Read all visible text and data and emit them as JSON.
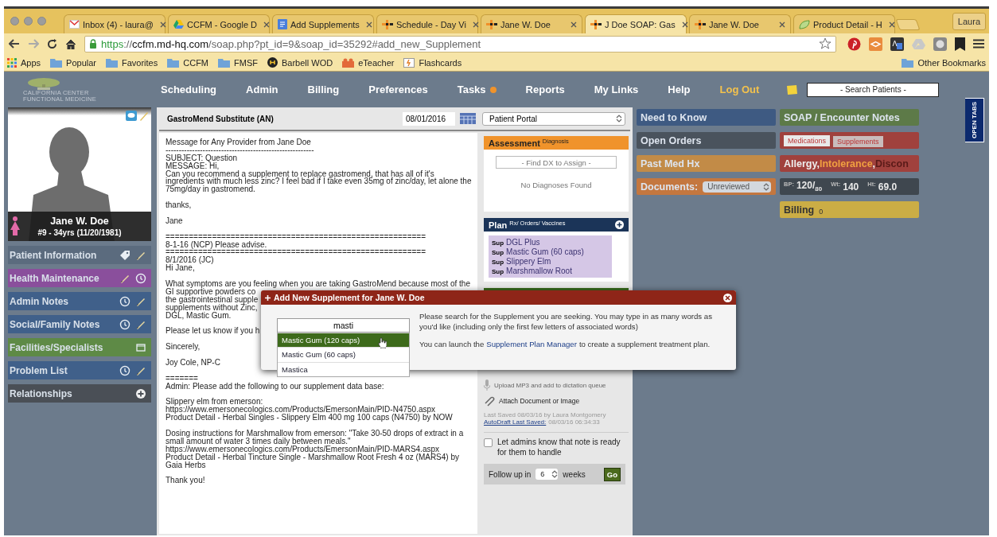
{
  "browser": {
    "tabs": [
      {
        "title": "Inbox (4) - laura@",
        "kind": "mail",
        "selected": false
      },
      {
        "title": "CCFM - Google D",
        "kind": "drive",
        "selected": false
      },
      {
        "title": "Add Supplements",
        "kind": "doc",
        "selected": false
      },
      {
        "title": "Schedule - Day Vi",
        "kind": "app",
        "selected": false
      },
      {
        "title": "Jane W. Doe",
        "kind": "app",
        "selected": false
      },
      {
        "title": "J Doe SOAP: Gas",
        "kind": "app",
        "selected": true
      },
      {
        "title": "Jane W. Doe",
        "kind": "app",
        "selected": false
      },
      {
        "title": "Product Detail - H",
        "kind": "leaf",
        "selected": false
      }
    ],
    "profile": "Laura",
    "url": [
      {
        "text": "https",
        "kind": "scheme"
      },
      {
        "text": "://",
        "kind": "sep"
      },
      {
        "text": "ccfm.md-hq.com",
        "kind": "host"
      },
      {
        "text": "/soap.php?pt_id=9&soap_id=35292#add_new_Supplement",
        "kind": "path"
      }
    ],
    "bookmarks": [
      {
        "label": "Apps",
        "kind": "apps"
      },
      {
        "label": "Popular",
        "kind": "folder"
      },
      {
        "label": "Favorites",
        "kind": "folder"
      },
      {
        "label": "CCFM",
        "kind": "folder"
      },
      {
        "label": "FMSF",
        "kind": "folder"
      },
      {
        "label": "Barbell WOD",
        "kind": "barbell"
      },
      {
        "label": "eTeacher",
        "kind": "teacher"
      },
      {
        "label": "Flashcards",
        "kind": "cards"
      }
    ],
    "other_bookmarks": "Other Bookmarks"
  },
  "header": {
    "logo": [
      "CALIFORNIA CENTER",
      "FUNCTIONAL MEDICINE"
    ],
    "nav": [
      {
        "label": "Scheduling",
        "kind": "link"
      },
      {
        "label": "Admin",
        "kind": "link"
      },
      {
        "label": "Billing",
        "kind": "link"
      },
      {
        "label": "Preferences",
        "kind": "link"
      },
      {
        "label": "Tasks",
        "kind": "alert"
      },
      {
        "label": "Reports",
        "kind": "link"
      },
      {
        "label": "My Links",
        "kind": "link"
      },
      {
        "label": "Help",
        "kind": "link"
      },
      {
        "label": "Log Out",
        "kind": "logout"
      }
    ],
    "search": {
      "placeholder": "- Search Patients -"
    }
  },
  "patient": {
    "name": "Jane W. Doe",
    "details": "#9 - 34yrs (11/20/1981)",
    "sidebar": [
      {
        "label": "Patient Information",
        "color": "#5b6b7e",
        "actions": [
          {
            "kind": "tag"
          },
          {
            "kind": "edit"
          }
        ]
      },
      {
        "label": "Health Maintenance",
        "color": "#8a4f9c",
        "actions": [
          {
            "kind": "edit"
          },
          {
            "kind": "history"
          }
        ]
      },
      {
        "label": "Admin Notes",
        "color": "#40608a",
        "actions": [
          {
            "kind": "history"
          },
          {
            "kind": "edit"
          }
        ]
      },
      {
        "label": "Social/Family Notes",
        "color": "#40608a",
        "actions": [
          {
            "kind": "history"
          },
          {
            "kind": "edit"
          }
        ]
      },
      {
        "label": "Facilities/Specialists",
        "color": "#5e8a46",
        "actions": [
          {
            "kind": "window"
          }
        ]
      },
      {
        "label": "Problem List",
        "color": "#40608a",
        "actions": [
          {
            "kind": "history"
          },
          {
            "kind": "edit"
          }
        ]
      },
      {
        "label": "Relationships",
        "color": "#4a4f56",
        "actions": [
          {
            "kind": "add"
          }
        ]
      }
    ]
  },
  "note": {
    "title": "GastroMend Substitute (AN)",
    "date": "08/01/2016",
    "channel": "Patient Portal",
    "message": [
      [
        "Message for Any Provider from Jane Doe",
        "--------------------------------------------------------",
        "SUBJECT: Question",
        "MESSAGE: Hi,",
        "Can you recommend a supplement to replace gastromend, that has all of it's",
        "ingredients with much less zinc? I feel bad if I take even 35mg of zinc/day, let alone the",
        "75mg/day in gastromend."
      ],
      [
        "thanks,"
      ],
      [
        "Jane"
      ],
      [
        "========================================================",
        "8-1-16 (NCP) Please advise.",
        "========================================================",
        "8/1/2016 (JC)",
        "Hi Jane,"
      ],
      [
        "What symptoms are you feeling when you are taking GastroMend because most of the",
        "GI supportive powders co",
        "the gastrointestinal supple",
        "supplements without Zinc,",
        "DGL, Mastic Gum."
      ],
      [
        "Please let us know if you h"
      ],
      [
        "Sincerely,"
      ],
      [
        "Joy Cole, NP-C"
      ],
      [
        "=======",
        "Admin: Please add the following to our supplement data base:"
      ],
      [
        "Slippery elm from emerson:",
        "https://www.emersonecologics.com/Products/EmersonMain/PID-N4750.aspx",
        "Product Detail - Herbal Singles - Slippery Elm 400 mg 100 caps (N4750) by NOW"
      ],
      [
        "Dosing instructions for Marshmallow from emerson: \"Take 30-50 drops of extract in a",
        "small amount of water 3 times daily between meals.\"",
        "https://www.emersonecologics.com/Products/EmersonMain/PID-MARS4.aspx",
        "Product Detail - Herbal Tincture Single - Marshmallow Root Fresh 4 oz (MARS4) by",
        "Gaia Herbs"
      ],
      [
        "Thank you!"
      ]
    ],
    "assessment": {
      "title": "Assessment",
      "subtitle": "Diagnosis",
      "placeholder": "- Find DX to Assign -",
      "empty": "No Diagnoses Found"
    },
    "plan": {
      "title": "Plan",
      "subtitle": "Rx/ Orders/ Vaccines",
      "items": [
        {
          "tag": "Sup",
          "name": "DGL Plus"
        },
        {
          "tag": "Sup",
          "name": "Mastic Gum (60 caps)"
        },
        {
          "tag": "Sup",
          "name": "Slippery Elm"
        },
        {
          "tag": "Sup",
          "name": "Marshmallow Root"
        }
      ]
    },
    "upload": "Upload MP3 and add to dictation queue",
    "attach": "Attach Document or Image",
    "last_saved": "Last Saved 08/03/16 by Laura Montgomery",
    "autodraft_link": "AutoDraft Last Saved:",
    "autodraft_time": "08/03/16 06:34:33",
    "notify": {
      "label": "Let admins know that note is ready for them to handle",
      "checked": false
    },
    "follow_up": {
      "label": "Follow up in",
      "value": "6",
      "unit": "weeks",
      "button": "Go"
    }
  },
  "panels": {
    "left": [
      {
        "kind": "panel",
        "label": "Need to Know",
        "color": "#3e5a82"
      },
      {
        "kind": "panel",
        "label": "Open Orders",
        "color": "#4a535d"
      },
      {
        "kind": "panel",
        "label": "Past Med Hx",
        "color": "#c28b47"
      },
      {
        "kind": "filter",
        "label": "Documents:",
        "value": "Unreviewed",
        "color": "#c4773f"
      }
    ],
    "right": [
      {
        "kind": "panel",
        "label": "SOAP / Encounter Notes",
        "color": "#5d7a48"
      },
      {
        "kind": "tabs",
        "color": "#a0413d",
        "tabs": [
          {
            "label": "Medications",
            "selected": true
          },
          {
            "label": "Supplements",
            "selected": false
          }
        ]
      },
      {
        "kind": "allergy",
        "color": "#a0413d",
        "parts": [
          {
            "text": "Allergy,",
            "kind": "allergy"
          },
          {
            "text": "Intolerance",
            "kind": "intolerance"
          },
          {
            "text": ",",
            "kind": "allergy"
          },
          {
            "text": "Discon",
            "kind": "discontinued"
          }
        ]
      },
      {
        "kind": "vitals",
        "color": "#3f474f",
        "items": [
          {
            "label": "BP:",
            "value": "120/$_{80}$"
          },
          {
            "label": "Wt:",
            "value": "140"
          },
          {
            "label": "Ht:",
            "value": "69.0"
          }
        ]
      },
      {
        "kind": "count",
        "label": "Billing",
        "count": "0",
        "color": "#cbad45"
      }
    ]
  },
  "open_tabs": "OPEN TABS",
  "modal": {
    "title": "Add New Supplement for Jane W. Doe",
    "query": "masti",
    "results": [
      {
        "label": "Mastic Gum (120 caps)",
        "selected": true
      },
      {
        "label": "Mastic Gum (60 caps)",
        "selected": false
      },
      {
        "label": "Mastica",
        "selected": false
      }
    ],
    "help": "Please search for the Supplement you are seeking. You may type in as many words as you'd like (including only the first few letters of associated words)",
    "launch": {
      "before": "You can launch the",
      "link": "Supplement Plan Manager",
      "after": "to create a supplement treatment plan."
    }
  }
}
